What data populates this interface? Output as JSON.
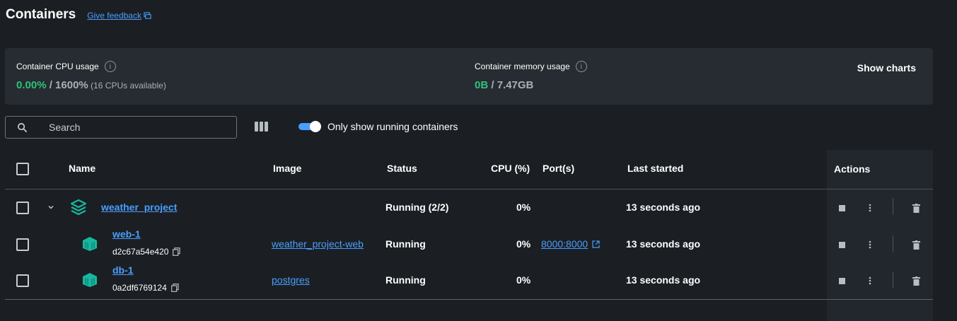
{
  "header": {
    "title": "Containers",
    "feedback_link": "Give feedback"
  },
  "stats": {
    "cpu_label": "Container CPU usage",
    "cpu_used": "0.00%",
    "cpu_total": " / 1600%",
    "cpu_note": " (16 CPUs available)",
    "memory_label": "Container memory usage",
    "memory_used": "0B",
    "memory_total": " / 7.47GB",
    "show_charts": "Show charts"
  },
  "toolbar": {
    "search_placeholder": "Search",
    "toggle_label": "Only show running containers",
    "toggle_on": true
  },
  "table": {
    "columns": [
      "Name",
      "Image",
      "Status",
      "CPU (%)",
      "Port(s)",
      "Last started",
      "Actions"
    ],
    "rows": [
      {
        "name": "weather_project",
        "image": "",
        "status": "Running (2/2)",
        "cpu": "0%",
        "ports": "",
        "last_started": "13 seconds ago"
      },
      {
        "name": "web-1",
        "id": "d2c67a54e420",
        "image": "weather_project-web",
        "status": "Running",
        "cpu": "0%",
        "ports": "8000:8000",
        "last_started": "13 seconds ago"
      },
      {
        "name": "db-1",
        "id": "0a2df6769124",
        "image": "postgres",
        "status": "Running",
        "cpu": "0%",
        "ports": "",
        "last_started": "13 seconds ago"
      }
    ]
  },
  "colors": {
    "accent": "#4a9eff",
    "green": "#2ec27e",
    "teal_icon": "#16b8a0",
    "background": "#1b1f23",
    "panel": "#262c31"
  }
}
